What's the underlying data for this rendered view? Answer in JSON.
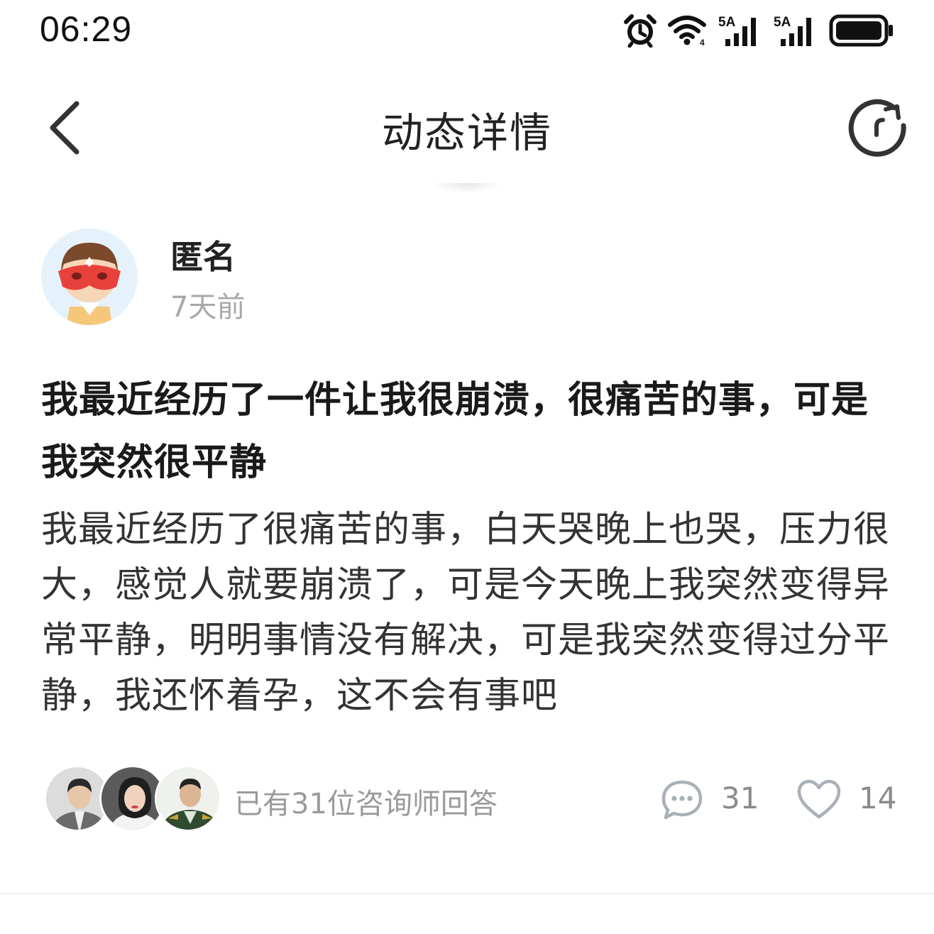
{
  "status_bar": {
    "time": "06:29",
    "icons": [
      "alarm-icon",
      "wifi-icon",
      "signal-5a-icon",
      "signal-5a-icon",
      "battery-icon"
    ],
    "signal_label_1": "5A",
    "signal_label_2": "5A"
  },
  "nav": {
    "title": "动态详情",
    "back_icon": "chevron-left-icon",
    "refresh_icon": "refresh-icon"
  },
  "post": {
    "author": "匿名",
    "time": "7天前",
    "title": "我最近经历了一件让我很崩溃，很痛苦的事，可是我突然很平静",
    "body": "我最近经历了很痛苦的事，白天哭晚上也哭，压力很大，感觉人就要崩溃了，可是今天晚上我突然变得异常平静，明明事情没有解决，可是我突然变得过分平静，我还怀着孕，这不会有事吧"
  },
  "stats": {
    "answers_text": "已有31位咨询师回答",
    "comment_count": "31",
    "like_count": "14"
  },
  "colors": {
    "accent_mask": "#e8413b",
    "muted_text": "#9a9a9a",
    "avatar_bg": "#e6f2fb"
  }
}
